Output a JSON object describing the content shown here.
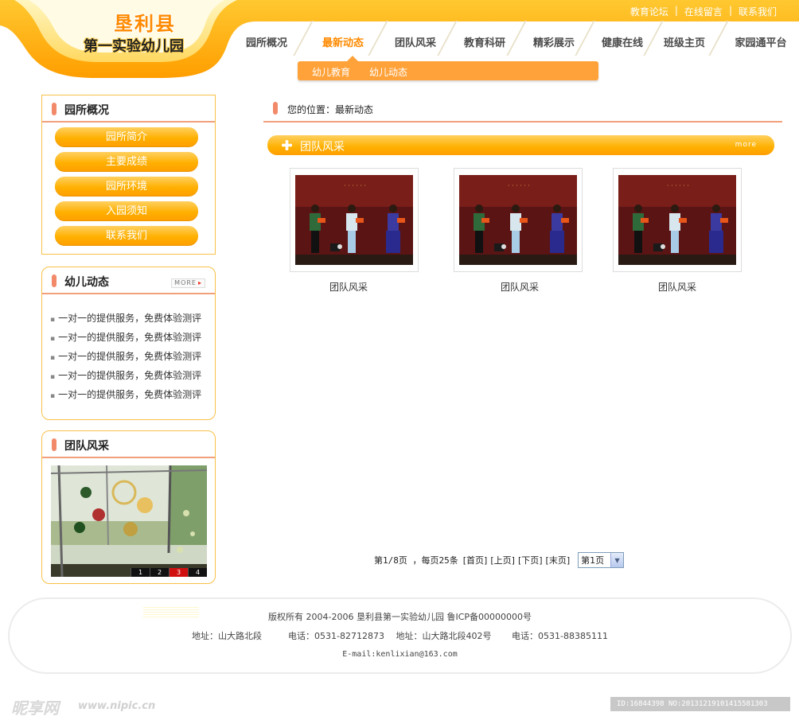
{
  "logo": {
    "line1": "垦利县",
    "line2": "第一实验幼儿园"
  },
  "toplinks": [
    "教育论坛",
    "在线留言",
    "联系我们"
  ],
  "nav": {
    "items": [
      "园所概况",
      "最新动态",
      "团队风采",
      "教育科研",
      "精彩展示",
      "健康在线",
      "班级主页",
      "家园通平台"
    ],
    "active": "最新动态"
  },
  "subnav": [
    "幼儿教育",
    "幼儿动态"
  ],
  "sidebar": {
    "overview": {
      "title": "园所概况",
      "items": [
        "园所简介",
        "主要成绩",
        "园所环境",
        "入园须知",
        "联系我们"
      ]
    },
    "news": {
      "title": "幼儿动态",
      "more": "MORE",
      "items": [
        "一对一的提供服务，免费体验测评",
        "一对一的提供服务，免费体验测评",
        "一对一的提供服务，免费体验测评",
        "一对一的提供服务，免费体验测评",
        "一对一的提供服务，免费体验测评"
      ]
    },
    "team": {
      "title": "团队风采",
      "slides": [
        "1",
        "2",
        "3",
        "4"
      ],
      "active_slide": "3"
    }
  },
  "main": {
    "breadcrumb": "您的位置：最新动态",
    "section_title": "团队风采",
    "section_more": "more",
    "photos": [
      {
        "caption": "团队风采"
      },
      {
        "caption": "团队风采"
      },
      {
        "caption": "团队风采"
      }
    ]
  },
  "pager": {
    "info": "第1/8页 ，每页25条",
    "links": [
      "[首页]",
      "[上页]",
      "[下页]",
      "[末页]"
    ],
    "select_value": "第1页"
  },
  "footer": {
    "copyright": "版权所有 2004-2006 垦利县第一实验幼儿园 鲁ICP备00000000号",
    "address": "地址：山大路北段　　　电话：0531-82712873　 地址：山大路北段402号　　 电话：0531-88385111",
    "email": "E-mail:kenlixian@163.com"
  },
  "watermark": {
    "logo": "昵享网",
    "url": "www.nipic.cn",
    "id": "ID:16844398 NO:20131219101415581303"
  },
  "colors": {
    "accent": "#ffa800",
    "nav_active": "#ff8a00",
    "divider": "#f2a07c",
    "border": "#f8c048"
  }
}
